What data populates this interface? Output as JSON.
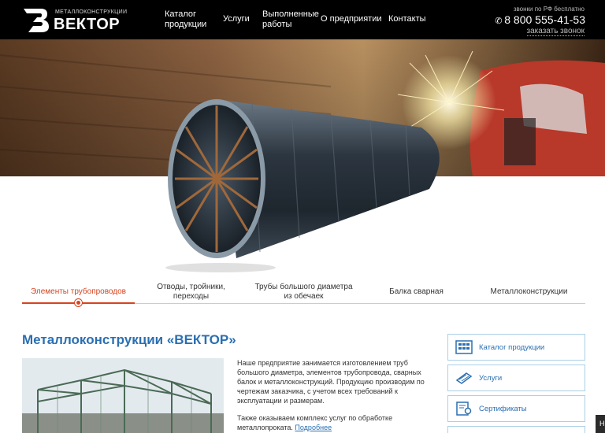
{
  "header": {
    "logo": {
      "subtitle": "МЕТАЛЛОКОНСТРУКЦИИ",
      "name": "ВЕКТОР"
    },
    "nav": [
      {
        "label": "Каталог\nпродукции"
      },
      {
        "label": "Услуги"
      },
      {
        "label": "Выполненные\nработы"
      },
      {
        "label": "О предприятии"
      },
      {
        "label": "Контакты"
      }
    ],
    "phone_note": "звонки по РФ бесплатно",
    "phone_icon": "phone-icon",
    "phone": "8 800 555-41-53",
    "callback": "заказать звонок"
  },
  "tabs": {
    "items": [
      {
        "label": "Элементы трубопроводов",
        "active": true
      },
      {
        "label": "Отводы, тройники,\nпереходы",
        "active": false
      },
      {
        "label": "Трубы большого диаметра\nиз обечаек",
        "active": false
      },
      {
        "label": "Балка сварная",
        "active": false
      },
      {
        "label": "Металлоконструкции",
        "active": false
      }
    ]
  },
  "main": {
    "title": "Металлоконструкции «ВЕКТОР»",
    "paragraph1": "Наше предприятие занимается изготовлением труб большого диаметра, элементов трубопровода, сварных балок и металлоконструкций. Продукцию производим по чертежам заказчика, с учетом всех требований к эксплуатации и размерам.",
    "paragraph2": "Также оказываем комплекс услуг по обработке металлопроката.",
    "more": "Подробнее"
  },
  "sidebar": {
    "items": [
      {
        "label": "Каталог продукции",
        "icon": "catalog-icon"
      },
      {
        "label": "Услуги",
        "icon": "services-icon"
      },
      {
        "label": "Сертификаты",
        "icon": "certificate-icon"
      }
    ]
  },
  "colors": {
    "accent": "#d7441f",
    "link": "#2a6fb2",
    "header_bg": "#000000",
    "sidebar_border": "#aad0e6"
  }
}
